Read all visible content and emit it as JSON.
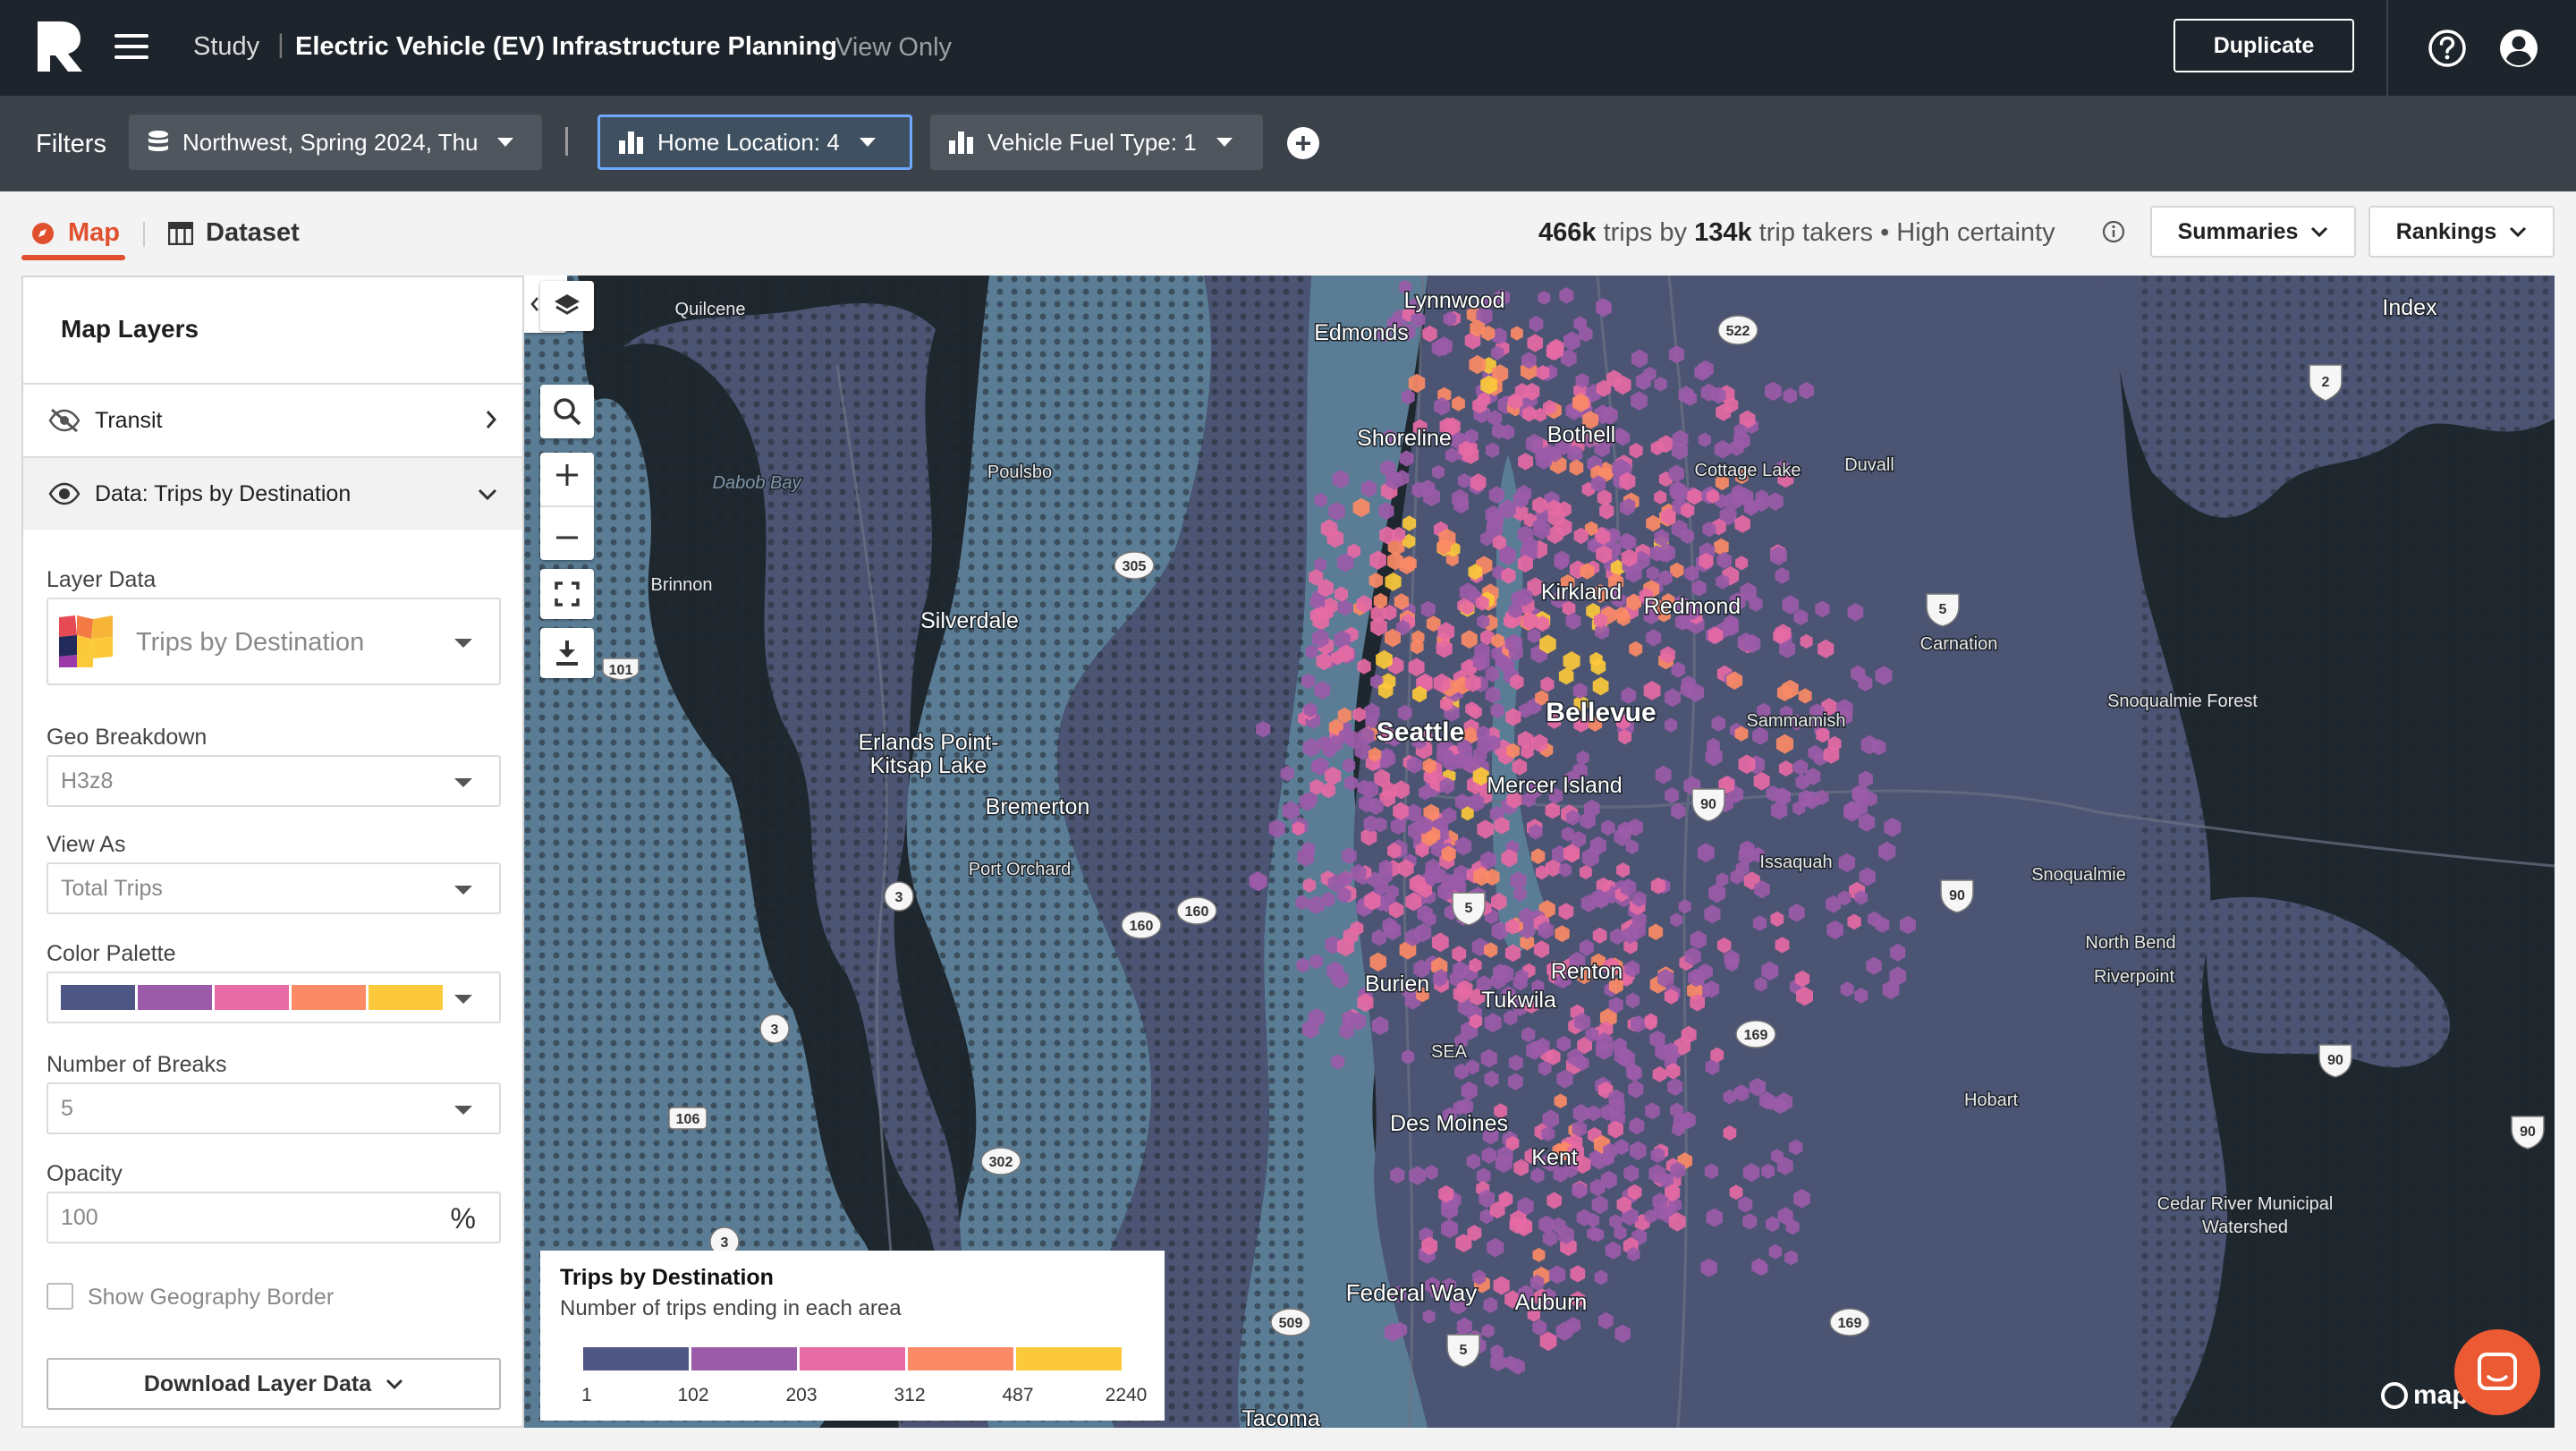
{
  "app": {
    "section": "Study",
    "title": "Electric Vehicle (EV) Infrastructure Planning",
    "mode": "View Only",
    "duplicate_label": "Duplicate"
  },
  "filters": {
    "label": "Filters",
    "items": [
      {
        "label": "Northwest, Spring 2024, Thu",
        "icon": "database-icon",
        "active": false
      },
      {
        "label": "Home Location: 4",
        "icon": "bar-chart-icon",
        "active": true
      },
      {
        "label": "Vehicle Fuel Type: 1",
        "icon": "bar-chart-icon",
        "active": false
      }
    ]
  },
  "tabs": {
    "map": "Map",
    "dataset": "Dataset"
  },
  "summary": {
    "trips": "466k",
    "trips_suffix": " trips by ",
    "takers": "134k",
    "takers_suffix": " trip takers",
    "bullet": "•",
    "certainty": "High certainty",
    "summaries_label": "Summaries",
    "rankings_label": "Rankings"
  },
  "panel": {
    "title": "Map Layers",
    "layers": [
      {
        "label": "Transit",
        "visible": false
      },
      {
        "label": "Data: Trips by Destination",
        "visible": true
      }
    ],
    "layer_data_label": "Layer Data",
    "layer_data_value": "Trips by Destination",
    "geo_label": "Geo Breakdown",
    "geo_value": "H3z8",
    "view_as_label": "View As",
    "view_as_value": "Total Trips",
    "palette_label": "Color Palette",
    "palette": [
      "#4e5784",
      "#9b5ba8",
      "#e66aa4",
      "#fb8a66",
      "#fbc93a"
    ],
    "breaks_label": "Number of Breaks",
    "breaks_value": "5",
    "opacity_label": "Opacity",
    "opacity_value": "100",
    "opacity_unit": "%",
    "border_label": "Show Geography Border",
    "download_label": "Download Layer Data"
  },
  "legend": {
    "title": "Trips by Destination",
    "subtitle": "Number of trips ending in each area",
    "colors": [
      "#4e5784",
      "#9b5ba8",
      "#e66aa4",
      "#fb8a66",
      "#fbc93a"
    ],
    "ticks": [
      "1",
      "102",
      "203",
      "312",
      "487",
      "2240"
    ]
  },
  "map": {
    "attribution": "mapbox",
    "places": {
      "quilcene": "Quilcene",
      "edmonds": "Edmonds",
      "lynnwood": "Lynnwood",
      "index": "Index",
      "shoreline": "Shoreline",
      "bothell": "Bothell",
      "dabob": "Dabob Bay",
      "poulsbo": "Poulsbo",
      "cottage": "Cottage Lake",
      "duvall": "Duvall",
      "brinnon": "Brinnon",
      "silverdale": "Silverdale",
      "kirkland": "Kirkland",
      "redmond": "Redmond",
      "carnation": "Carnation",
      "snoqforest": "Snoqualmie Forest",
      "seattle": "Seattle",
      "bellevue": "Bellevue",
      "sammamish": "Sammamish",
      "erlands1": "Erlands Point-",
      "erlands2": "Kitsap Lake",
      "mercer": "Mercer Island",
      "bremerton": "Bremerton",
      "issaquah": "Issaquah",
      "portorchard": "Port Orchard",
      "snoqualmie": "Snoqualmie",
      "northbend": "North Bend",
      "renton": "Renton",
      "burien": "Burien",
      "riverpoint": "Riverpoint",
      "tukwila": "Tukwila",
      "sea": "SEA",
      "hobart": "Hobart",
      "desmoines": "Des Moines",
      "kent": "Kent",
      "cedar1": "Cedar River Municipal",
      "cedar2": "Watershed",
      "federalway": "Federal Way",
      "auburn": "Auburn",
      "tacoma": "Tacoma"
    },
    "shields": {
      "s522": "522",
      "s2": "2",
      "s305": "305",
      "s5a": "5",
      "s101": "101",
      "s90a": "90",
      "s3a": "3",
      "s160a": "160",
      "s160b": "160",
      "s5b": "5",
      "s90b": "90",
      "s90c": "90",
      "s3b": "3",
      "s169a": "169",
      "s90d": "90",
      "s106": "106",
      "s302": "302",
      "s3c": "3",
      "s509": "509",
      "s169b": "169",
      "s5c": "5"
    }
  }
}
